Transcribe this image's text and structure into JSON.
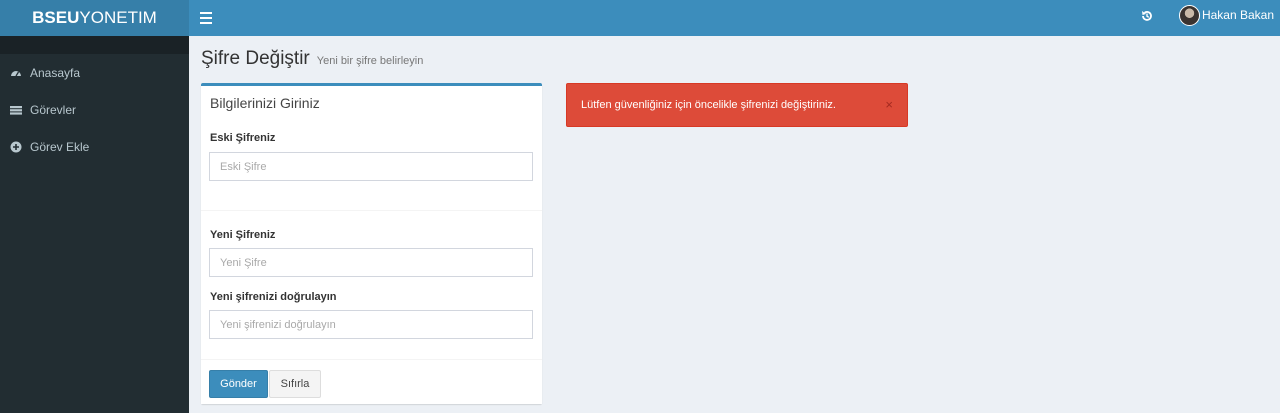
{
  "brand": {
    "bold": "BSEU",
    "light": "YONETIM"
  },
  "header": {
    "username": "Hakan Bakan"
  },
  "sidebar": {
    "items": [
      {
        "label": "Anasayfa",
        "icon": "dashboard-icon"
      },
      {
        "label": "Görevler",
        "icon": "tasks-icon"
      },
      {
        "label": "Görev Ekle",
        "icon": "plus-circle-icon"
      }
    ]
  },
  "page": {
    "title": "Şifre Değiştir",
    "subtitle": "Yeni bir şifre belirleyin"
  },
  "form": {
    "title": "Bilgilerinizi Giriniz",
    "old_label": "Eski Şifreniz",
    "old_placeholder": "Eski Şifre",
    "new_label": "Yeni Şifreniz",
    "new_placeholder": "Yeni Şifre",
    "confirm_label": "Yeni şifrenizi doğrulayın",
    "confirm_placeholder": "Yeni şifrenizi doğrulayın",
    "submit": "Gönder",
    "reset": "Sıfırla"
  },
  "alert": {
    "message": "Lütfen güvenliğiniz için öncelikle şifrenizi değiştiriniz.",
    "close": "×"
  },
  "colors": {
    "primary": "#3c8dbc",
    "sidebar": "#222d32",
    "danger": "#dd4b39",
    "background": "#ecf0f5"
  }
}
